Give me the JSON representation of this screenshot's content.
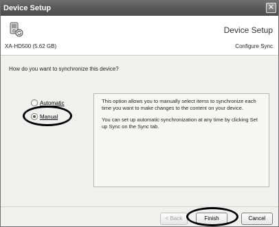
{
  "window": {
    "title": "Device Setup",
    "close_glyph": "✕"
  },
  "header": {
    "title": "Device Setup",
    "device_name": "XA-HD500 (5.62 GB)",
    "subtitle": "Configure Sync",
    "icon": "device-icon"
  },
  "main": {
    "question": "How do you want to synchronize this device?",
    "options": [
      {
        "label": "Automatic",
        "selected": false
      },
      {
        "label": "Manual",
        "selected": true
      }
    ],
    "info_paragraphs": [
      "This option allows you to manually select items to synchronize each time you want to make changes to the content on your device.",
      "You can set up automatic synchronization at any time by clicking Set up Sync on the Sync tab."
    ]
  },
  "footer": {
    "back_label": "< Back",
    "finish_label": "Finish",
    "cancel_label": "Cancel"
  }
}
